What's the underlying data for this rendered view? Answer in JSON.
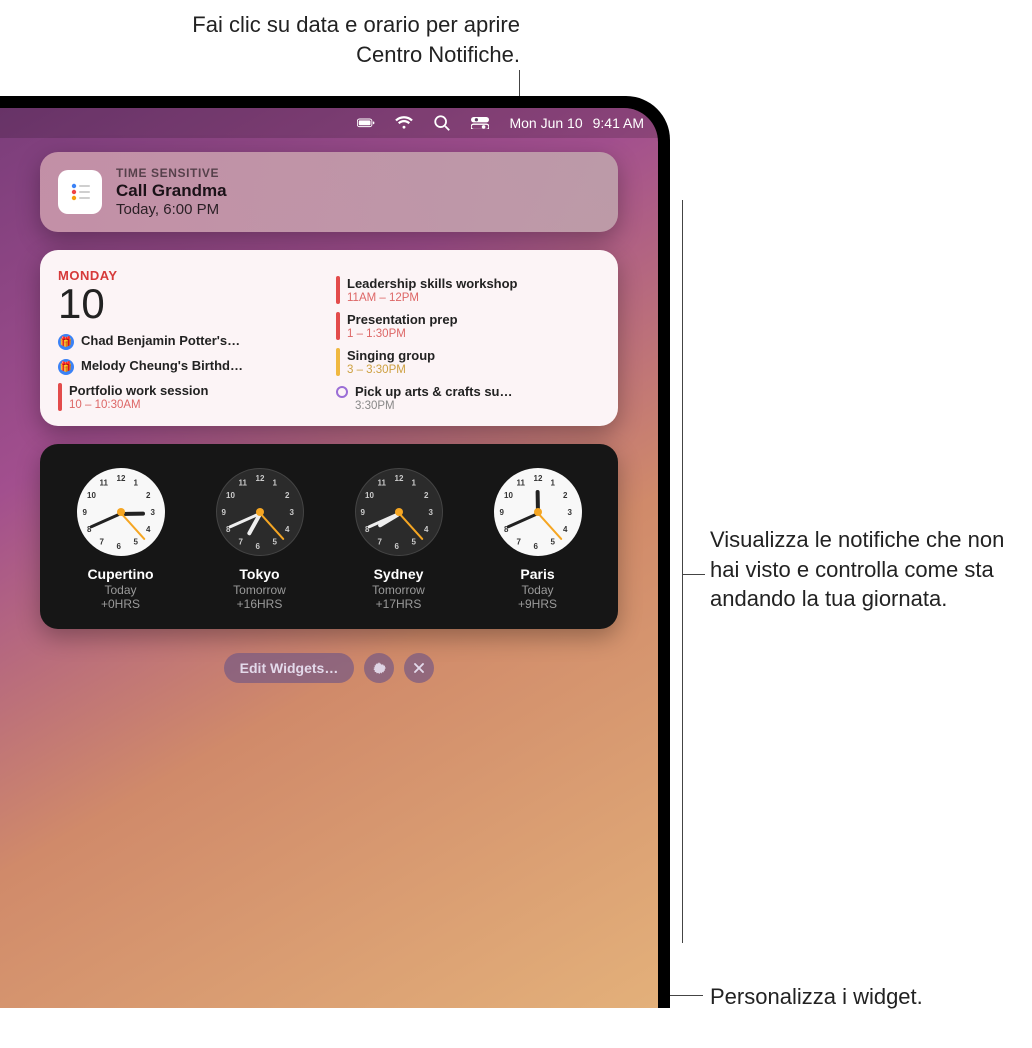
{
  "callouts": {
    "top": "Fai clic su data e orario per aprire Centro Notifiche.",
    "right": "Visualizza le notifiche che non hai visto e controlla come sta andando la tua giornata.",
    "bottom": "Personalizza i widget."
  },
  "menubar": {
    "date": "Mon Jun 10",
    "time": "9:41 AM"
  },
  "notification": {
    "tag": "TIME SENSITIVE",
    "title": "Call Grandma",
    "subtitle": "Today, 6:00 PM"
  },
  "calendar": {
    "day_label": "MONDAY",
    "day_num": "10",
    "left_events": [
      {
        "kind": "dot",
        "title": "Chad Benjamin Potter's…"
      },
      {
        "kind": "dot",
        "title": "Melody Cheung's Birthd…"
      },
      {
        "kind": "pipe",
        "color": "red",
        "title": "Portfolio work session",
        "time": "10 – 10:30AM"
      }
    ],
    "right_events": [
      {
        "kind": "pipe",
        "color": "red",
        "title": "Leadership skills workshop",
        "time": "11AM – 12PM"
      },
      {
        "kind": "pipe",
        "color": "red",
        "title": "Presentation prep",
        "time": "1 – 1:30PM"
      },
      {
        "kind": "pipe",
        "color": "yel",
        "title": "Singing group",
        "time": "3 – 3:30PM"
      },
      {
        "kind": "ring",
        "title": "Pick up arts & crafts su…",
        "time": "3:30PM"
      }
    ]
  },
  "clocks": [
    {
      "city": "Cupertino",
      "day": "Today",
      "offset": "+0HRS",
      "face": "day",
      "h_deg": -1,
      "m_deg": 156,
      "s_deg": 48
    },
    {
      "city": "Tokyo",
      "day": "Tomorrow",
      "offset": "+16HRS",
      "face": "night",
      "h_deg": 119,
      "m_deg": 156,
      "s_deg": 48
    },
    {
      "city": "Sydney",
      "day": "Tomorrow",
      "offset": "+17HRS",
      "face": "night",
      "h_deg": 149,
      "m_deg": 156,
      "s_deg": 48
    },
    {
      "city": "Paris",
      "day": "Today",
      "offset": "+9HRS",
      "face": "day",
      "h_deg": 269,
      "m_deg": 156,
      "s_deg": 48
    }
  ],
  "controls": {
    "edit": "Edit Widgets…"
  }
}
